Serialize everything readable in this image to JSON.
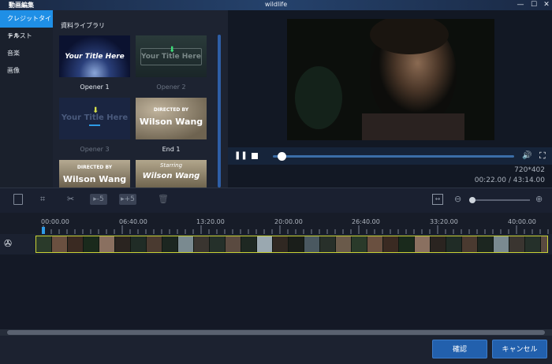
{
  "titlebar": {
    "app_title": "動画編集",
    "window_title": "wildlife",
    "minimize": "—",
    "maximize": "☐",
    "close": "✕"
  },
  "categories": [
    "クレジットタイトル",
    "テキスト",
    "音楽",
    "画像"
  ],
  "library": {
    "title": "資料ライブラリ",
    "thumbs": [
      {
        "caption": "Opener 1",
        "text": "Your Title Here",
        "style": "opener1",
        "enabled": true
      },
      {
        "caption": "Opener 2",
        "text": "Your Title Here",
        "style": "opener2",
        "enabled": false
      },
      {
        "caption": "Opener 3",
        "text": "Your Title Here",
        "style": "opener3",
        "enabled": false
      },
      {
        "caption": "End 1",
        "text_top": "DIRECTED BY",
        "text": "Wilson Wang",
        "style": "end1",
        "enabled": true
      },
      {
        "text_top": "DIRECTED BY",
        "text": "Wilson Wang",
        "style": "end2"
      },
      {
        "text_top": "Starring",
        "text": "Wilson Wang",
        "style": "end3"
      }
    ]
  },
  "preview": {
    "resolution": "720*402",
    "time": "00:22.00 / 43:14.00",
    "progress": 0.02
  },
  "toolbar": {
    "rewind_label": "▸-5",
    "forward_label": "▸+5"
  },
  "ruler": [
    "00:00.00",
    "06:40.00",
    "13:20.00",
    "20:00.00",
    "26:40.00",
    "33:20.00",
    "40:00.00"
  ],
  "footer": {
    "confirm": "確認",
    "cancel": "キャンセル"
  },
  "colors": {
    "accent": "#1f8fe6",
    "button": "#2260ad",
    "clip_border": "#c9d235"
  }
}
